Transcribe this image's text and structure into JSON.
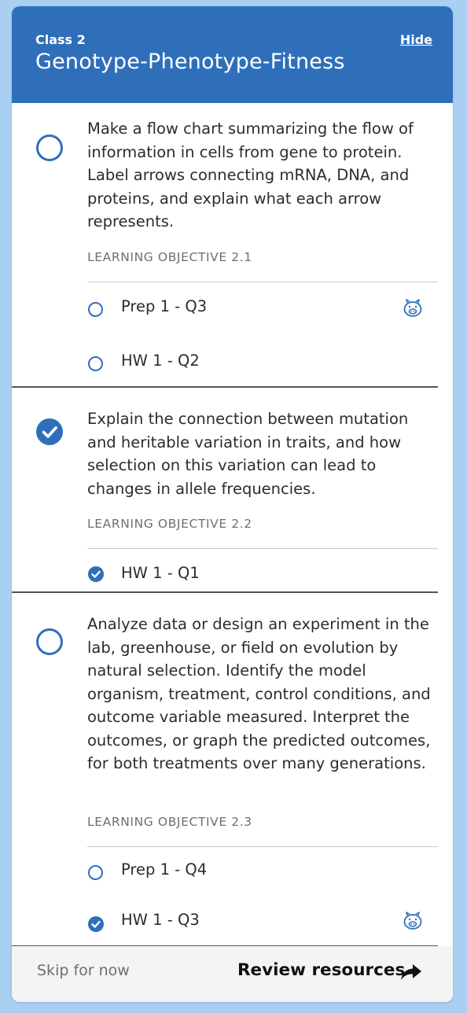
{
  "header": {
    "class_label": "Class 2",
    "title": "Genotype-Phenotype-Fitness",
    "hide_label": "Hide"
  },
  "objectives": [
    {
      "status": "incomplete",
      "text": "Make a flow chart summarizing the flow of information in cells from gene to protein. Label arrows connecting mRNA, DNA, and proteins, and explain what each arrow represents.",
      "label": "LEARNING OBJECTIVE 2.1",
      "items": [
        {
          "label": "Prep 1 - Q3",
          "status": "incomplete",
          "icon": "piggy-icon"
        },
        {
          "label": "HW 1 - Q2",
          "status": "incomplete",
          "icon": ""
        }
      ]
    },
    {
      "status": "complete",
      "text": "Explain the connection between mutation and heritable variation in traits, and how selection on this variation can lead to changes in allele frequencies.",
      "label": "LEARNING OBJECTIVE 2.2",
      "items": [
        {
          "label": "HW 1 - Q1",
          "status": "complete",
          "icon": ""
        }
      ]
    },
    {
      "status": "incomplete",
      "text": "Analyze data or design an experiment in the lab, greenhouse, or field on evolution by natural selection. Identify the model organism, treatment, control conditions, and outcome variable measured. Interpret the outcomes, or graph the predicted outcomes, for both treatments over many generations.",
      "label": "LEARNING OBJECTIVE 2.3",
      "items": [
        {
          "label": "Prep 1 - Q4",
          "status": "incomplete",
          "icon": ""
        },
        {
          "label": "HW 1 - Q3",
          "status": "complete",
          "icon": "piggy-icon"
        }
      ]
    }
  ],
  "footer": {
    "skip_label": "Skip for now",
    "review_label": "Review resources"
  },
  "side_chevrons": [
    "〉",
    "〉",
    "〉"
  ],
  "colors": {
    "accent": "#2f6fba",
    "page_background": "#a9d0f3",
    "label_gray": "#6b6f75"
  }
}
